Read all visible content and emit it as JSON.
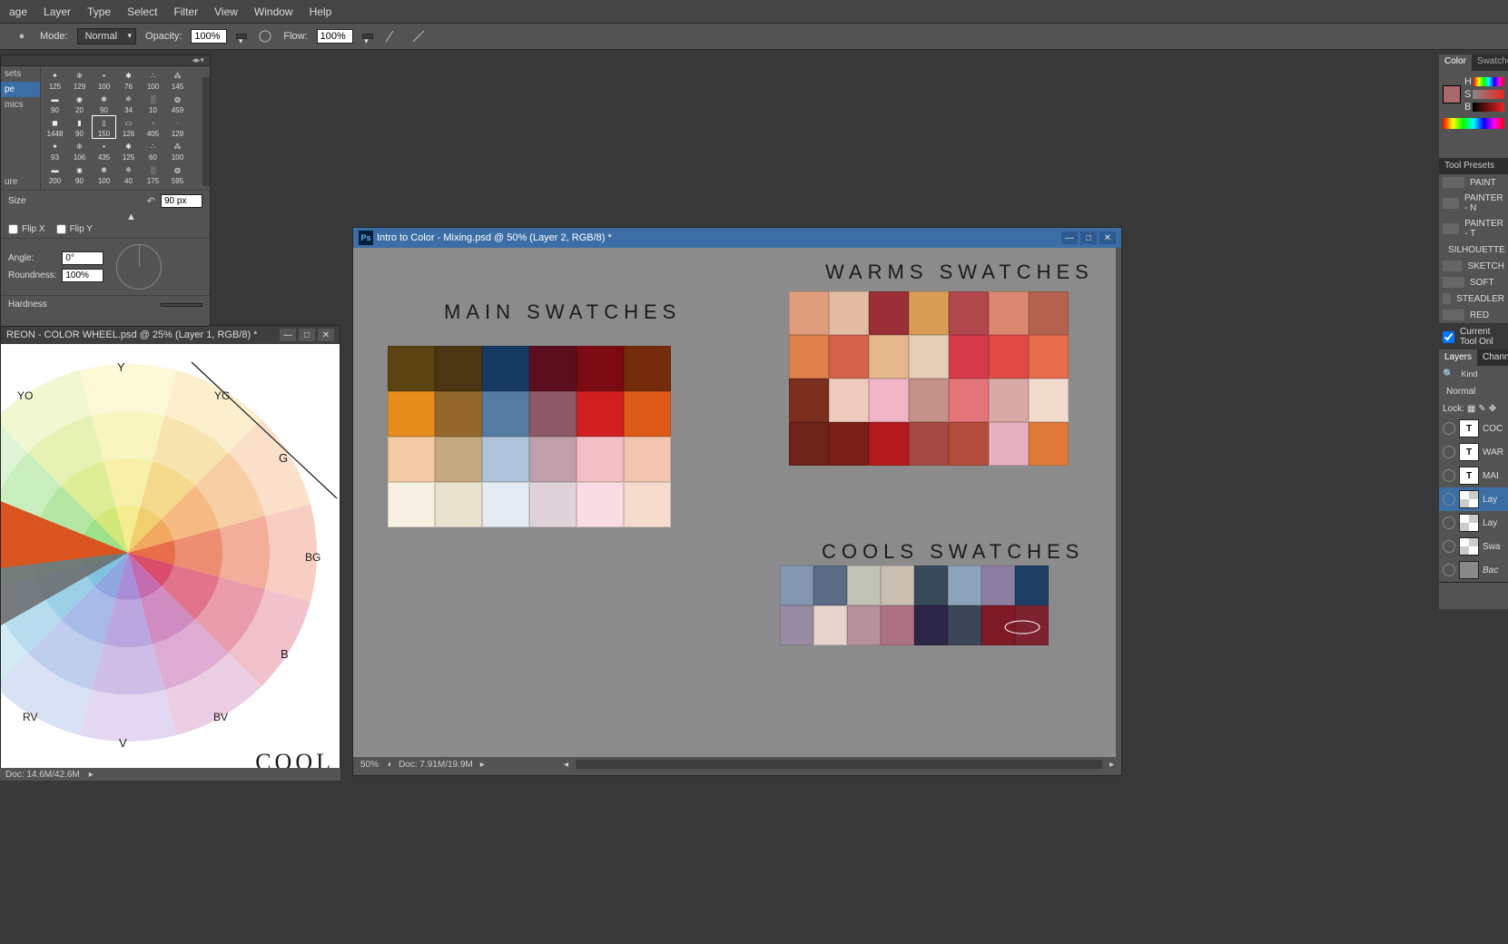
{
  "menu": {
    "items": [
      "age",
      "Layer",
      "Type",
      "Select",
      "Filter",
      "View",
      "Window",
      "Help"
    ]
  },
  "optbar": {
    "mode_lbl": "Mode:",
    "mode_val": "Normal",
    "opacity_lbl": "Opacity:",
    "opacity_val": "100%",
    "flow_lbl": "Flow:",
    "flow_val": "100%"
  },
  "brushpanel": {
    "side": [
      "sets",
      "pe",
      "mics",
      "",
      "",
      "",
      "",
      "ure"
    ],
    "side_hl_index": 1,
    "brushes": [
      {
        "n": "125"
      },
      {
        "n": "129"
      },
      {
        "n": "100"
      },
      {
        "n": "76"
      },
      {
        "n": "100"
      },
      {
        "n": "145"
      },
      {
        "n": "90"
      },
      {
        "n": "20"
      },
      {
        "n": "90"
      },
      {
        "n": "34"
      },
      {
        "n": "10"
      },
      {
        "n": "459"
      },
      {
        "n": "1448"
      },
      {
        "n": "90"
      },
      {
        "n": "150",
        "sel": true
      },
      {
        "n": "126"
      },
      {
        "n": "405"
      },
      {
        "n": "128"
      },
      {
        "n": "93"
      },
      {
        "n": "106"
      },
      {
        "n": "435"
      },
      {
        "n": "125"
      },
      {
        "n": "60"
      },
      {
        "n": "100"
      },
      {
        "n": "200"
      },
      {
        "n": "90"
      },
      {
        "n": "100"
      },
      {
        "n": "40"
      },
      {
        "n": "175"
      },
      {
        "n": "595"
      }
    ],
    "size_lbl": "Size",
    "size_val": "90 px",
    "flipx": "Flip X",
    "flipy": "Flip Y",
    "angle_lbl": "Angle:",
    "angle_val": "0°",
    "round_lbl": "Roundness:",
    "round_val": "100%",
    "hardness_lbl": "Hardness"
  },
  "cw_win": {
    "title": "REON - COLOR WHEEL.psd @ 25% (Layer 1, RGB/8) *",
    "labels": {
      "Y": "Y",
      "YO": "YO",
      "YG": "YG",
      "G": "G",
      "BG": "BG",
      "B": "B",
      "BV": "BV",
      "V": "V",
      "RV": "RV"
    },
    "cool": "COOL"
  },
  "mix_win": {
    "title": "Intro to Color - Mixing.psd @ 50% (Layer 2, RGB/8) *",
    "zoom": "50%",
    "docinfo": "Doc: 7.91M/19.9M",
    "main_title": "MAIN SWATCHES",
    "warms_title": "WARMS SWATCHES",
    "cools_title": "COOLS SWATCHES",
    "main": [
      [
        "#5b4411",
        "#4b3512",
        "#173a63",
        "#5c0e1e",
        "#7b0a12",
        "#742c0c"
      ],
      [
        "#e68d1c",
        "#94682d",
        "#557ba1",
        "#8f5866",
        "#d11e1e",
        "#dd5a18"
      ],
      [
        "#f2caa3",
        "#c3aa7f",
        "#aec3da",
        "#c0a1ab",
        "#f4bec7",
        "#f3c5b0"
      ],
      [
        "#f7f1e3",
        "#e9e2cf",
        "#e4ebf3",
        "#e0d2d9",
        "#fadde4",
        "#f6dcce"
      ]
    ],
    "warms": [
      [
        "#e09d7e",
        "#e3bba1",
        "#9a2f37",
        "#d89c56",
        "#b0474c",
        "#dc8871",
        "#b5614f"
      ],
      [
        "#de8049",
        "#d5634c",
        "#e4b78b",
        "#e6cfb8",
        "#d53b4b",
        "#e04b48",
        "#e86d4a"
      ],
      [
        "#7b2f1f",
        "#efcabf",
        "#f0b6c6",
        "#c59289",
        "#e5747a",
        "#d9a9a7",
        "#f0dbcd"
      ],
      [
        "#6d2318",
        "#7a1f18",
        "#b3181e",
        "#a44843",
        "#b14d3a",
        "#e6b0bf",
        "#e07a39"
      ]
    ],
    "cools": [
      [
        "#8596b0",
        "#5b6b85",
        "#c1c3b9",
        "#c8bdaf",
        "#384a59",
        "#8da3bb",
        "#8c7ea1",
        "#1d3f63"
      ],
      [
        "#978ba1",
        "#e6d3cb",
        "#b7929a",
        "#ab7180",
        "#2b2546",
        "#3c4556",
        "#7e1a26",
        "#7d2330"
      ]
    ]
  },
  "leftstatus": {
    "zoom": "",
    "doc": "Doc: 14.6M/42.6M"
  },
  "color_panel": {
    "tabs": [
      "Color",
      "Swatches"
    ],
    "active": 0,
    "h": "H",
    "s": "S",
    "b": "B"
  },
  "tool_presets": {
    "title": "Tool Presets",
    "items": [
      "PAINT",
      "PAINTER - N",
      "PAINTER - T",
      "SILHOUETTE",
      "SKETCH",
      "SOFT",
      "STEADLER",
      "RED"
    ],
    "current": "Current Tool Onl"
  },
  "layers": {
    "tabs": [
      "Layers",
      "Channel"
    ],
    "active": 0,
    "filter": "Kind",
    "blend": "Normal",
    "lock": "Lock:",
    "items": [
      {
        "t": "T",
        "name": "COC"
      },
      {
        "t": "T",
        "name": "WAR"
      },
      {
        "t": "T",
        "name": "MAI"
      },
      {
        "t": "thumb",
        "name": "Lay",
        "sel": true
      },
      {
        "t": "thumb",
        "name": "Lay"
      },
      {
        "t": "thumb",
        "name": "Swa"
      },
      {
        "t": "solid",
        "name": "Bac",
        "italic": true
      }
    ]
  }
}
